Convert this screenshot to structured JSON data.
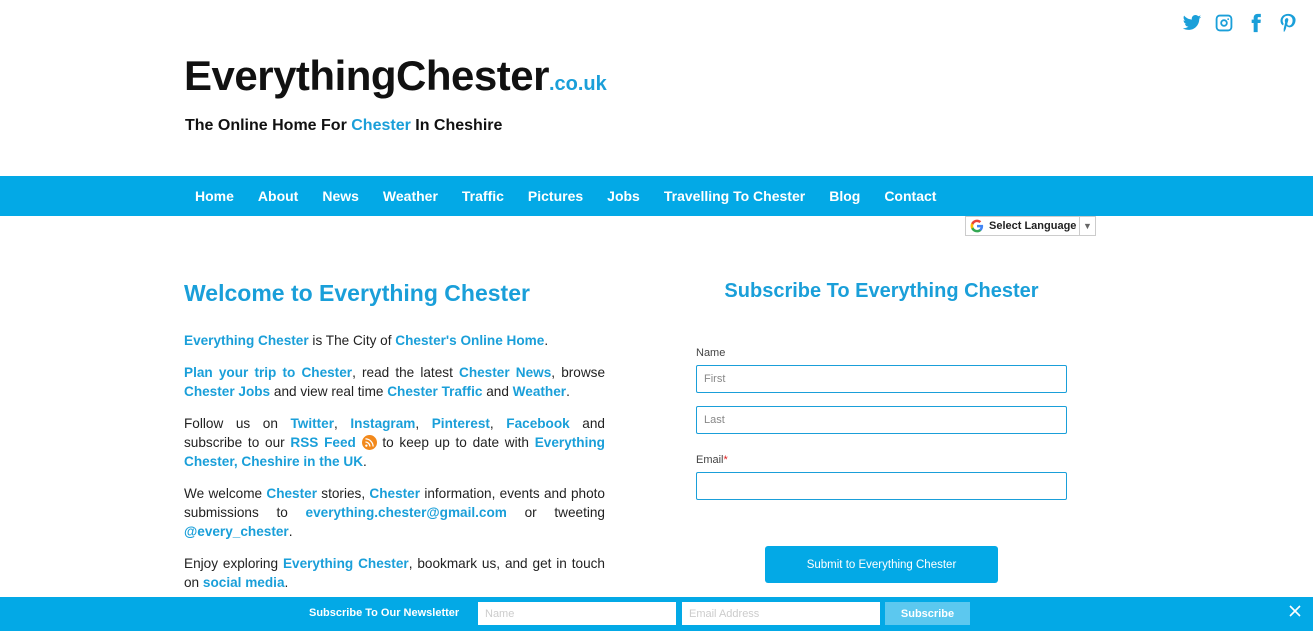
{
  "social": [
    "twitter-icon",
    "instagram-icon",
    "facebook-icon",
    "pinterest-icon"
  ],
  "brand": {
    "name": "EverythingChester",
    "tld": ".co.uk"
  },
  "tagline": {
    "pre": "The Online Home For ",
    "hl": "Chester",
    "post": " In Cheshire"
  },
  "nav": [
    "Home",
    "About",
    "News",
    "Weather",
    "Traffic",
    "Pictures",
    "Jobs",
    "Travelling To Chester",
    "Blog",
    "Contact"
  ],
  "translate": {
    "label": "Select Language",
    "arrow": "▼"
  },
  "welcome": {
    "title": "Welcome to Everything Chester",
    "p1": {
      "a": "Everything Chester",
      "b": " is The City of ",
      "c": "Chester's Online Home",
      "d": "."
    },
    "p2": {
      "a": "Plan your trip to Chester",
      "b": ", read the latest ",
      "c": "Chester News",
      "d": ", browse ",
      "e": "Chester Jobs",
      "f": " and view real time ",
      "g": "Chester Traffic",
      "h": " and ",
      "i": "Weather",
      "j": "."
    },
    "p3": {
      "a": "Follow us on ",
      "b": "Twitter",
      "c": ", ",
      "d": "Instagram",
      "e": ", ",
      "f": "Pinterest",
      "g": ", ",
      "h": "Facebook",
      "i": " and subscribe to our ",
      "j": "RSS Feed",
      "k": " to keep up to date with ",
      "l": "Everything Chester, Cheshire in the UK",
      "m": "."
    },
    "p4": {
      "a": "We welcome ",
      "b": "Chester",
      "c": " stories, ",
      "d": "Chester",
      "e": " information, events and photo submissions to ",
      "f": "everything.chester@gmail.com",
      "g": " or tweeting ",
      "h": "@every_chester",
      "i": "."
    },
    "p5": {
      "a": "Enjoy exploring ",
      "b": "Everything Chester",
      "c": ", bookmark us, and get in touch on ",
      "d": "social media",
      "e": "."
    }
  },
  "subscribe": {
    "title": "Subscribe To Everything Chester",
    "name_label": "Name",
    "first_placeholder": "First",
    "last_placeholder": "Last",
    "email_label": "Email",
    "required_mark": "*",
    "submit": "Submit to Everything Chester"
  },
  "newsletter": {
    "title": "Subscribe To Our Newsletter",
    "name_placeholder": "Name",
    "email_placeholder": "Email Address",
    "button": "Subscribe"
  }
}
